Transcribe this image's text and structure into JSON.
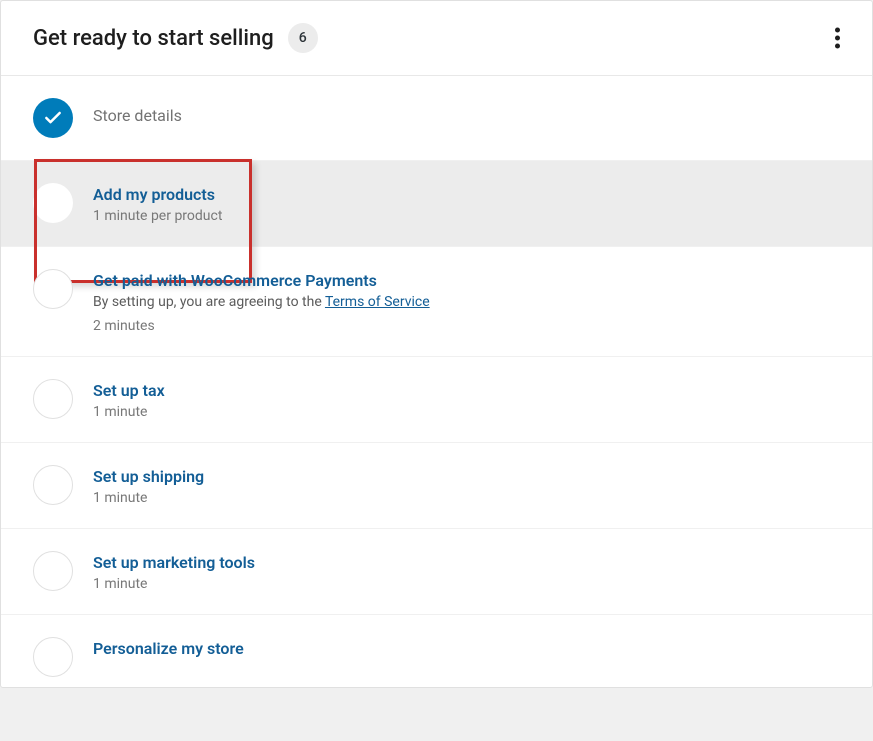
{
  "header": {
    "title": "Get ready to start selling",
    "badge_count": "6"
  },
  "tasks": [
    {
      "title": "Store details",
      "status": "done"
    },
    {
      "title": "Add my products",
      "meta": "1 minute per product",
      "status": "pending",
      "highlighted": true
    },
    {
      "title": "Get paid with WooCommerce Payments",
      "description_prefix": "By setting up, you are agreeing to the ",
      "description_link": "Terms of Service",
      "meta": "2 minutes",
      "status": "pending"
    },
    {
      "title": "Set up tax",
      "meta": "1 minute",
      "status": "pending"
    },
    {
      "title": "Set up shipping",
      "meta": "1 minute",
      "status": "pending"
    },
    {
      "title": "Set up marketing tools",
      "meta": "1 minute",
      "status": "pending"
    },
    {
      "title": "Personalize my store",
      "status": "pending"
    }
  ]
}
